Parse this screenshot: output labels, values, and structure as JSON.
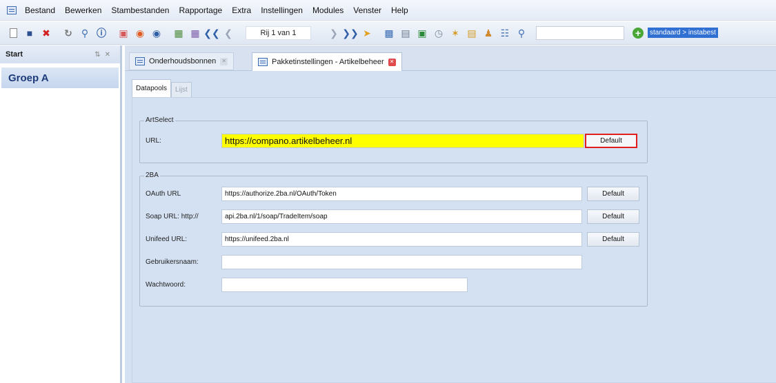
{
  "menu": {
    "items": [
      "Bestand",
      "Bewerken",
      "Stambestanden",
      "Rapportage",
      "Extra",
      "Instellingen",
      "Modules",
      "Venster",
      "Help"
    ]
  },
  "toolbar": {
    "record_label": "Rij 1 van 1",
    "search_value": "",
    "profile": "standaard > instabest"
  },
  "left_panel": {
    "title": "Start",
    "group": "Groep A"
  },
  "tabs": [
    {
      "label": "Onderhoudsbonnen"
    },
    {
      "label": "Pakketinstellingen - Artikelbeheer"
    }
  ],
  "inner_tabs": {
    "active": "Datapools",
    "inactive": "Lijst"
  },
  "artselect": {
    "title": "ArtSelect",
    "url_label": "URL:",
    "url_value": "https://compano.artikelbeheer.nl",
    "default_label": "Default"
  },
  "twoba": {
    "title": "2BA",
    "oauth_label": "OAuth URL",
    "oauth_value": "https://authorize.2ba.nl/OAuth/Token",
    "soap_label": "Soap URL: http://",
    "soap_value": "api.2ba.nl/1/soap/TradeItem/soap",
    "unifeed_label": "Unifeed URL:",
    "unifeed_value": "https://unifeed.2ba.nl",
    "user_label": "Gebruikersnaam:",
    "user_value": "",
    "password_label": "Wachtwoord:",
    "password_value": "",
    "default_label": "Default"
  },
  "colors": {
    "highlight": "#ffff00",
    "callout": "#e01c1c",
    "profile": "#3070d3"
  }
}
